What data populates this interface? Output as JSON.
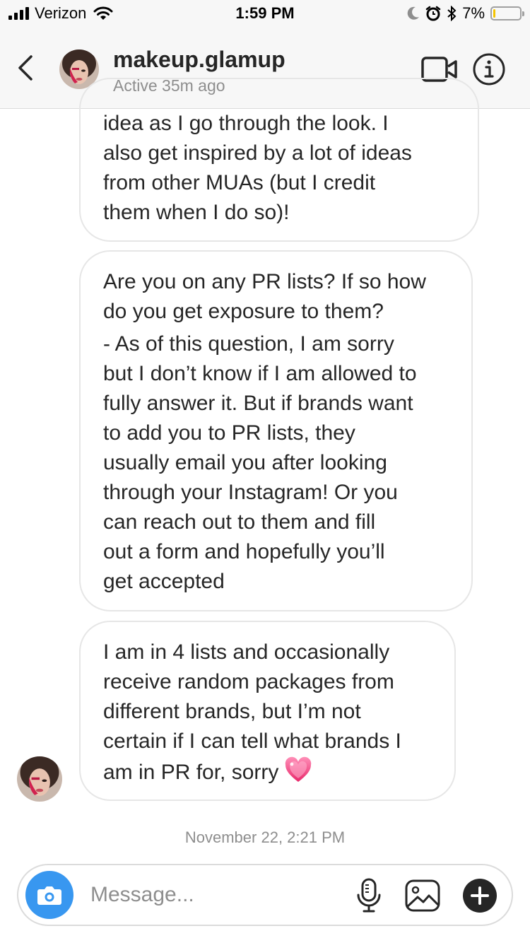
{
  "status_bar": {
    "carrier": "Verizon",
    "time": "1:59 PM",
    "battery_percent": "7%",
    "battery_level": 0.07,
    "icons": [
      "signal-icon",
      "wifi-icon",
      "moon-icon",
      "alarm-icon",
      "bluetooth-icon",
      "battery-icon"
    ]
  },
  "header": {
    "username": "makeup.glamup",
    "status": "Active 35m ago",
    "icons": [
      "back-chevron-icon",
      "video-call-icon",
      "info-icon"
    ]
  },
  "messages": [
    {
      "lines": [
        "idea as I go through the look. I",
        "also get inspired by a lot of ideas",
        "from other MUAs (but I credit",
        "them when I do so)!"
      ]
    },
    {
      "question_lines": [
        "Are you on any PR lists? If so how",
        "do you get exposure to them?"
      ],
      "answer_lines": [
        "- As of this question, I am sorry",
        "but I don’t know if I am allowed to",
        "fully answer it. But if brands want",
        "to add you to PR lists, they",
        "usually email you after looking",
        "through your Instagram! Or you",
        "can reach out to them and  fill",
        "out a form and hopefully you’ll",
        "get accepted"
      ]
    },
    {
      "lines": [
        "I am in 4 lists and occasionally",
        "receive random packages from",
        "different brands, but I’m not",
        "certain if I can tell what brands I",
        "am in PR for, sorry"
      ],
      "emoji": "sparkling-heart-icon"
    }
  ],
  "timestamp": "November 22, 2:21 PM",
  "composer": {
    "placeholder": "Message...",
    "icons": [
      "camera-icon",
      "microphone-icon",
      "gallery-icon",
      "plus-icon"
    ]
  },
  "colors": {
    "accent_blue": "#3897f0",
    "bubble_border": "#e6e6e6",
    "secondary_text": "#8e8e8e",
    "battery_low": "#f5c400",
    "heart_pink": "#f0447f"
  }
}
